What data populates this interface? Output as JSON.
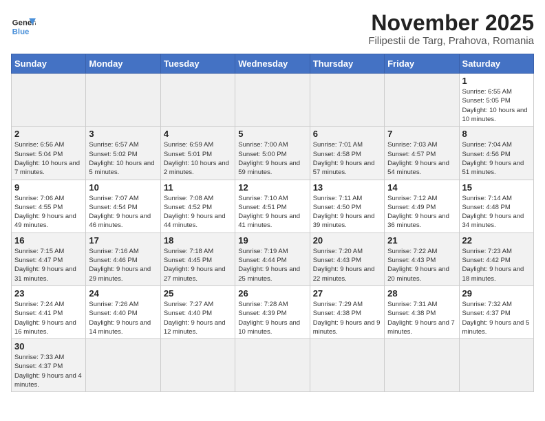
{
  "logo": {
    "text_general": "General",
    "text_blue": "Blue"
  },
  "title": "November 2025",
  "location": "Filipestii de Targ, Prahova, Romania",
  "weekdays": [
    "Sunday",
    "Monday",
    "Tuesday",
    "Wednesday",
    "Thursday",
    "Friday",
    "Saturday"
  ],
  "weeks": [
    [
      {
        "day": "",
        "info": ""
      },
      {
        "day": "",
        "info": ""
      },
      {
        "day": "",
        "info": ""
      },
      {
        "day": "",
        "info": ""
      },
      {
        "day": "",
        "info": ""
      },
      {
        "day": "",
        "info": ""
      },
      {
        "day": "1",
        "info": "Sunrise: 6:55 AM\nSunset: 5:05 PM\nDaylight: 10 hours\nand 10 minutes."
      }
    ],
    [
      {
        "day": "2",
        "info": "Sunrise: 6:56 AM\nSunset: 5:04 PM\nDaylight: 10 hours\nand 7 minutes."
      },
      {
        "day": "3",
        "info": "Sunrise: 6:57 AM\nSunset: 5:02 PM\nDaylight: 10 hours\nand 5 minutes."
      },
      {
        "day": "4",
        "info": "Sunrise: 6:59 AM\nSunset: 5:01 PM\nDaylight: 10 hours\nand 2 minutes."
      },
      {
        "day": "5",
        "info": "Sunrise: 7:00 AM\nSunset: 5:00 PM\nDaylight: 9 hours\nand 59 minutes."
      },
      {
        "day": "6",
        "info": "Sunrise: 7:01 AM\nSunset: 4:58 PM\nDaylight: 9 hours\nand 57 minutes."
      },
      {
        "day": "7",
        "info": "Sunrise: 7:03 AM\nSunset: 4:57 PM\nDaylight: 9 hours\nand 54 minutes."
      },
      {
        "day": "8",
        "info": "Sunrise: 7:04 AM\nSunset: 4:56 PM\nDaylight: 9 hours\nand 51 minutes."
      }
    ],
    [
      {
        "day": "9",
        "info": "Sunrise: 7:06 AM\nSunset: 4:55 PM\nDaylight: 9 hours\nand 49 minutes."
      },
      {
        "day": "10",
        "info": "Sunrise: 7:07 AM\nSunset: 4:54 PM\nDaylight: 9 hours\nand 46 minutes."
      },
      {
        "day": "11",
        "info": "Sunrise: 7:08 AM\nSunset: 4:52 PM\nDaylight: 9 hours\nand 44 minutes."
      },
      {
        "day": "12",
        "info": "Sunrise: 7:10 AM\nSunset: 4:51 PM\nDaylight: 9 hours\nand 41 minutes."
      },
      {
        "day": "13",
        "info": "Sunrise: 7:11 AM\nSunset: 4:50 PM\nDaylight: 9 hours\nand 39 minutes."
      },
      {
        "day": "14",
        "info": "Sunrise: 7:12 AM\nSunset: 4:49 PM\nDaylight: 9 hours\nand 36 minutes."
      },
      {
        "day": "15",
        "info": "Sunrise: 7:14 AM\nSunset: 4:48 PM\nDaylight: 9 hours\nand 34 minutes."
      }
    ],
    [
      {
        "day": "16",
        "info": "Sunrise: 7:15 AM\nSunset: 4:47 PM\nDaylight: 9 hours\nand 31 minutes."
      },
      {
        "day": "17",
        "info": "Sunrise: 7:16 AM\nSunset: 4:46 PM\nDaylight: 9 hours\nand 29 minutes."
      },
      {
        "day": "18",
        "info": "Sunrise: 7:18 AM\nSunset: 4:45 PM\nDaylight: 9 hours\nand 27 minutes."
      },
      {
        "day": "19",
        "info": "Sunrise: 7:19 AM\nSunset: 4:44 PM\nDaylight: 9 hours\nand 25 minutes."
      },
      {
        "day": "20",
        "info": "Sunrise: 7:20 AM\nSunset: 4:43 PM\nDaylight: 9 hours\nand 22 minutes."
      },
      {
        "day": "21",
        "info": "Sunrise: 7:22 AM\nSunset: 4:43 PM\nDaylight: 9 hours\nand 20 minutes."
      },
      {
        "day": "22",
        "info": "Sunrise: 7:23 AM\nSunset: 4:42 PM\nDaylight: 9 hours\nand 18 minutes."
      }
    ],
    [
      {
        "day": "23",
        "info": "Sunrise: 7:24 AM\nSunset: 4:41 PM\nDaylight: 9 hours\nand 16 minutes."
      },
      {
        "day": "24",
        "info": "Sunrise: 7:26 AM\nSunset: 4:40 PM\nDaylight: 9 hours\nand 14 minutes."
      },
      {
        "day": "25",
        "info": "Sunrise: 7:27 AM\nSunset: 4:40 PM\nDaylight: 9 hours\nand 12 minutes."
      },
      {
        "day": "26",
        "info": "Sunrise: 7:28 AM\nSunset: 4:39 PM\nDaylight: 9 hours\nand 10 minutes."
      },
      {
        "day": "27",
        "info": "Sunrise: 7:29 AM\nSunset: 4:38 PM\nDaylight: 9 hours\nand 9 minutes."
      },
      {
        "day": "28",
        "info": "Sunrise: 7:31 AM\nSunset: 4:38 PM\nDaylight: 9 hours\nand 7 minutes."
      },
      {
        "day": "29",
        "info": "Sunrise: 7:32 AM\nSunset: 4:37 PM\nDaylight: 9 hours\nand 5 minutes."
      }
    ],
    [
      {
        "day": "30",
        "info": "Sunrise: 7:33 AM\nSunset: 4:37 PM\nDaylight: 9 hours\nand 4 minutes."
      },
      {
        "day": "",
        "info": ""
      },
      {
        "day": "",
        "info": ""
      },
      {
        "day": "",
        "info": ""
      },
      {
        "day": "",
        "info": ""
      },
      {
        "day": "",
        "info": ""
      },
      {
        "day": "",
        "info": ""
      }
    ]
  ]
}
